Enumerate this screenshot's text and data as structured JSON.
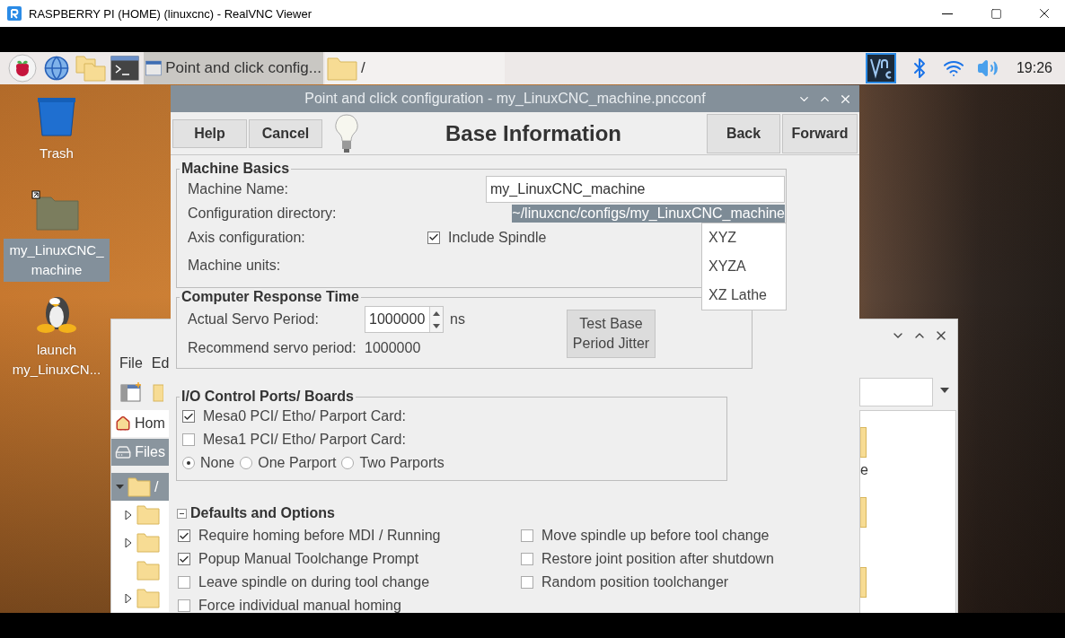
{
  "vnc_window": {
    "title": "RASPBERRY PI (HOME) (linuxcnc) - RealVNC Viewer"
  },
  "taskbar": {
    "tasks": [
      {
        "kind": "window",
        "label": "Point and click config...",
        "selected": true
      },
      {
        "kind": "folder",
        "label": "/",
        "selected": false
      }
    ],
    "clock": "19:26"
  },
  "desktop_icons": [
    {
      "kind": "trash",
      "label": "Trash",
      "selected": false
    },
    {
      "kind": "folder",
      "label": "my_LinuxCNC_machine",
      "selected": true
    },
    {
      "kind": "penguin",
      "label": "launch my_LinuxCN...",
      "selected": false
    }
  ],
  "file_manager": {
    "menu": [
      "File",
      "Ed"
    ],
    "places": [
      {
        "kind": "home",
        "label": "Hom",
        "selected": false
      },
      {
        "kind": "drive",
        "label": "Files",
        "selected": true
      }
    ],
    "tree": {
      "label": "/",
      "selected": true,
      "expanded": true,
      "children": [
        {
          "expandable": true
        },
        {
          "expandable": true
        },
        {
          "expandable": false
        },
        {
          "expandable": true
        }
      ]
    },
    "file_labels": [
      "e"
    ]
  },
  "dialog": {
    "title": "Point and click configuration - my_LinuxCNC_machine.pncconf",
    "left_buttons": [
      "Help",
      "Cancel"
    ],
    "heading": "Base Information",
    "right_buttons": [
      "Back",
      "Forward"
    ],
    "machine_basics": {
      "title": "Machine Basics",
      "machine_name_label": "Machine Name:",
      "machine_name": "my_LinuxCNC_machine",
      "config_dir_label": "Configuration directory:",
      "config_dir": "~/linuxcnc/configs/my_LinuxCNC_machine",
      "config_dir_selected": true,
      "axis_label": "Axis configuration:",
      "include_spindle": {
        "label": "Include Spindle",
        "checked": true
      },
      "units_label": "Machine units:",
      "axis_options": [
        {
          "label": "XYZ",
          "selected": false
        },
        {
          "label": "XYZA",
          "selected": false
        },
        {
          "label": "XZ Lathe",
          "selected": false
        }
      ]
    },
    "response_time": {
      "title": "Computer Response Time",
      "servo_label": "Actual Servo Period:",
      "servo_value": "1000000",
      "servo_unit": "ns",
      "recommend_label": "Recommend servo period:",
      "recommend_value": "1000000",
      "test_button": "Test Base Period Jitter"
    },
    "io_ports": {
      "title": "I/O Control Ports/ Boards",
      "cards": [
        {
          "label": "Mesa0 PCI/ Etho/ Parport Card:",
          "checked": true
        },
        {
          "label": "Mesa1 PCI/ Etho/ Parport Card:",
          "checked": false
        }
      ],
      "parport_options": [
        {
          "label": "None",
          "selected": true
        },
        {
          "label": "One Parport",
          "selected": false
        },
        {
          "label": "Two Parports",
          "selected": false
        }
      ]
    },
    "defaults": {
      "title": "Defaults and Options",
      "expanded": true,
      "left_options": [
        {
          "label": "Require homing before MDI / Running",
          "checked": true
        },
        {
          "label": "Popup Manual Toolchange Prompt",
          "checked": true
        },
        {
          "label": "Leave spindle on during tool change",
          "checked": false
        },
        {
          "label": "Force individual manual homing",
          "checked": false
        }
      ],
      "right_options": [
        {
          "label": "Move spindle up before tool change",
          "checked": false
        },
        {
          "label": "Restore joint position after shutdown",
          "checked": false
        },
        {
          "label": "Random position toolchanger",
          "checked": false
        }
      ]
    }
  }
}
